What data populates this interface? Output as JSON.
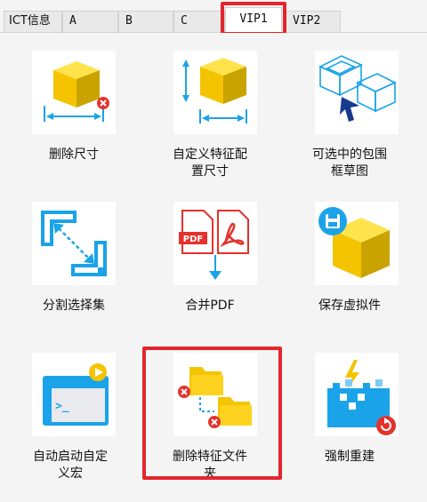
{
  "tabs": [
    {
      "label": "ICT信息"
    },
    {
      "label": "A"
    },
    {
      "label": "B"
    },
    {
      "label": "C"
    },
    {
      "label": "VIP1"
    },
    {
      "label": "VIP2"
    }
  ],
  "active_tab": "VIP1",
  "tools": [
    {
      "label": "删除尺寸",
      "icon": "cube-dimension-delete-icon"
    },
    {
      "label": "自定义特征配置尺寸",
      "icon": "cube-dimension-config-icon"
    },
    {
      "label": "可选中的包围框草图",
      "icon": "bounding-box-sketch-icon"
    },
    {
      "label": "分割选择集",
      "icon": "split-selection-icon"
    },
    {
      "label": "合并PDF",
      "icon": "merge-pdf-icon"
    },
    {
      "label": "保存虚拟件",
      "icon": "save-virtual-part-icon"
    },
    {
      "label": "自动启动自定义宏",
      "icon": "auto-start-macro-icon"
    },
    {
      "label": "删除特征文件夹",
      "icon": "delete-feature-folder-icon"
    },
    {
      "label": "强制重建",
      "icon": "force-rebuild-icon"
    }
  ],
  "colors": {
    "highlight": "#e4252d",
    "accent_blue": "#1aa3e8",
    "cube_yellow": "#f4c400",
    "pdf_red": "#e5312b"
  }
}
